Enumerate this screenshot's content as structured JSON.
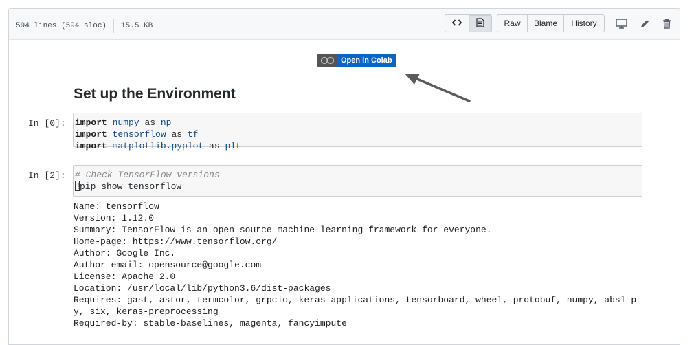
{
  "file_header": {
    "lines": "594 lines (594 sloc)",
    "size": "15.5 KB",
    "buttons": [
      "Raw",
      "Blame",
      "History"
    ],
    "icons": [
      "code-icon",
      "file-text-icon",
      "desktop-icon",
      "pencil-icon",
      "trash-icon"
    ]
  },
  "badge": {
    "text": "Open in Colab",
    "logo_text": "CO"
  },
  "heading": "Set up the Environment",
  "cells": [
    {
      "prompt": "In [0]:",
      "lines": [
        [
          {
            "t": "import",
            "c": "kw"
          },
          {
            "t": " "
          },
          {
            "t": "numpy",
            "c": "nm"
          },
          {
            "t": " as "
          },
          {
            "t": "np",
            "c": "nm"
          }
        ],
        [
          {
            "t": "import",
            "c": "kw"
          },
          {
            "t": " "
          },
          {
            "t": "tensorflow",
            "c": "nm"
          },
          {
            "t": " as "
          },
          {
            "t": "tf",
            "c": "nm"
          }
        ],
        [
          {
            "t": "import",
            "c": "kw"
          },
          {
            "t": " "
          },
          {
            "t": "matplotlib.pyplot",
            "c": "nm"
          },
          {
            "t": " as "
          },
          {
            "t": "plt",
            "c": "nm"
          }
        ]
      ]
    },
    {
      "prompt": "In [2]:",
      "lines": [
        [
          {
            "t": "# Check TensorFlow versions",
            "c": "cm"
          }
        ],
        [
          {
            "t": "!",
            "c": "cursor"
          },
          {
            "t": "pip show tensorflow"
          }
        ]
      ]
    }
  ],
  "output": [
    "Name: tensorflow",
    "Version: 1.12.0",
    "Summary: TensorFlow is an open source machine learning framework for everyone.",
    "Home-page: https://www.tensorflow.org/",
    "Author: Google Inc.",
    "Author-email: opensource@google.com",
    "License: Apache 2.0",
    "Location: /usr/local/lib/python3.6/dist-packages",
    "Requires: gast, astor, termcolor, grpcio, keras-applications, tensorboard, wheel, protobuf, numpy, absl-p",
    "y, six, keras-preprocessing",
    "Required-by: stable-baselines, magenta, fancyimpute"
  ],
  "colors": {
    "badge_blue": "#0f64c0",
    "badge_gray": "#555555",
    "code_name": "#0e4d8a"
  }
}
